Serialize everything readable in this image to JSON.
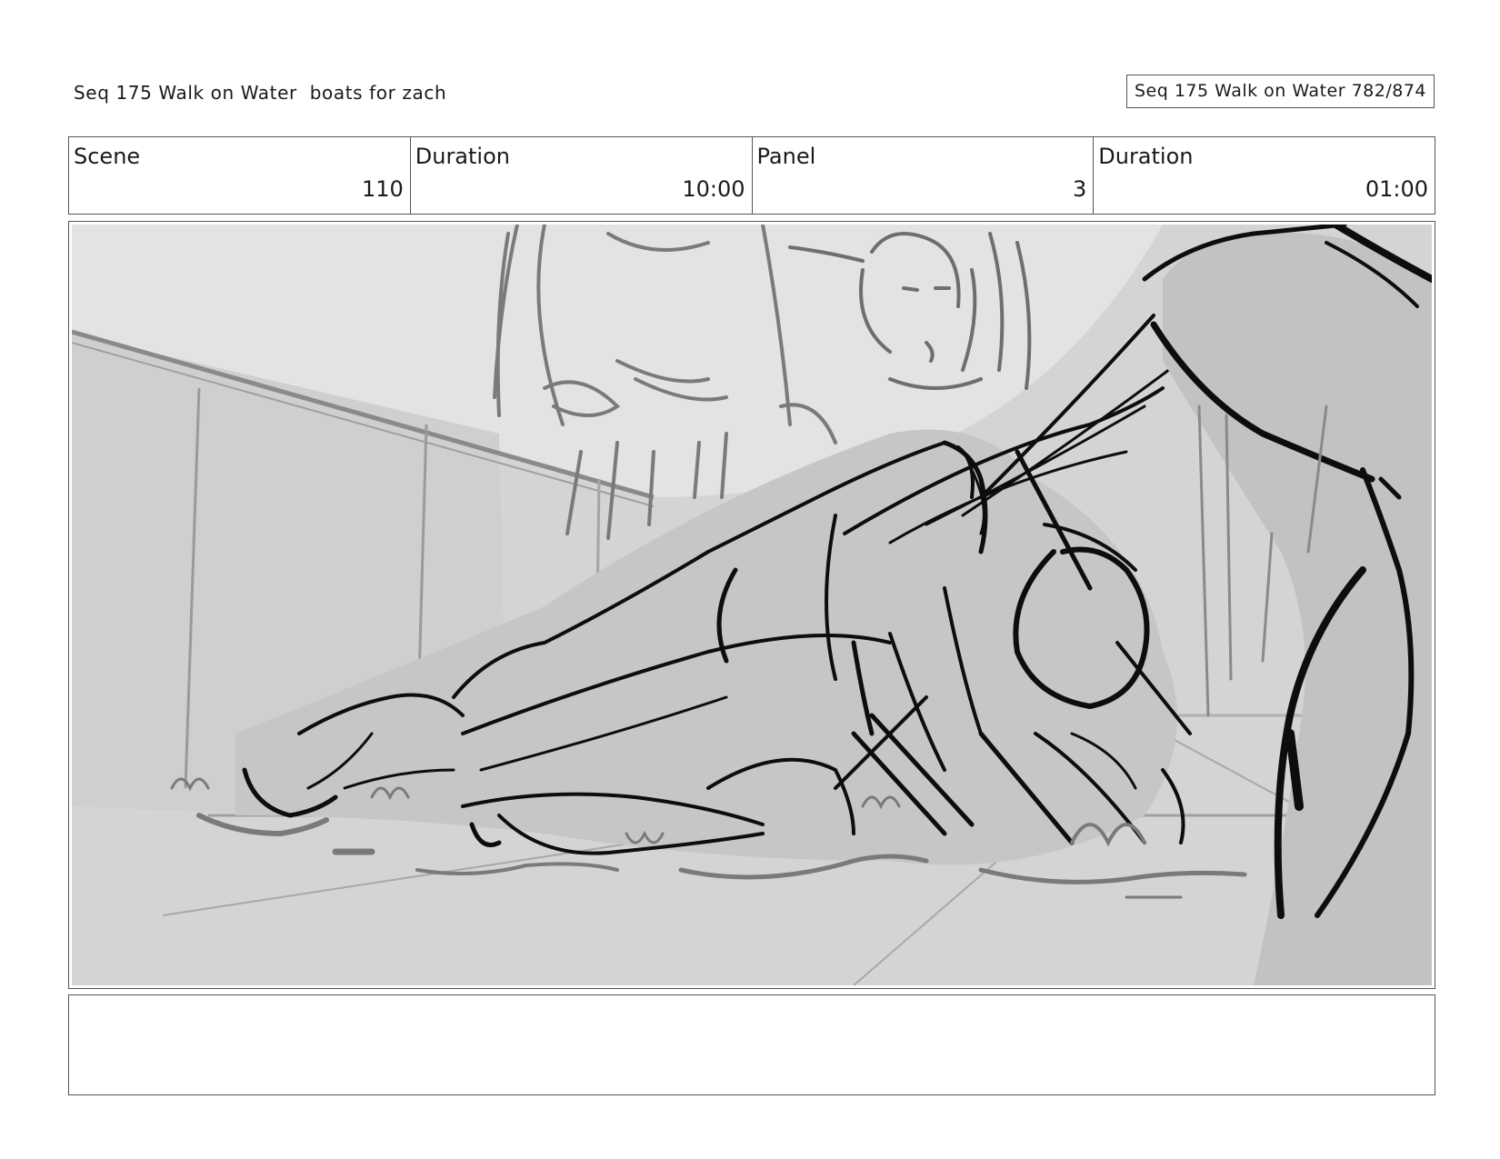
{
  "header": {
    "sequence_title": "Seq 175 Walk on Water  boats for zach",
    "page_ref": "Seq 175 Walk on Water 782/874"
  },
  "info": {
    "scene_label": "Scene",
    "scene_value": "110",
    "scene_duration_label": "Duration",
    "scene_duration_value": "10:00",
    "panel_label": "Panel",
    "panel_value": "3",
    "panel_duration_label": "Duration",
    "panel_duration_value": "01:00"
  },
  "notes": {
    "text": ""
  },
  "colors": {
    "sketch_background": "#d4d4d4",
    "wall_light": "#e3e3e3",
    "line_dark": "#0d0d0d",
    "line_mid": "#7a7a7a",
    "line_light": "#9c9c9c"
  }
}
